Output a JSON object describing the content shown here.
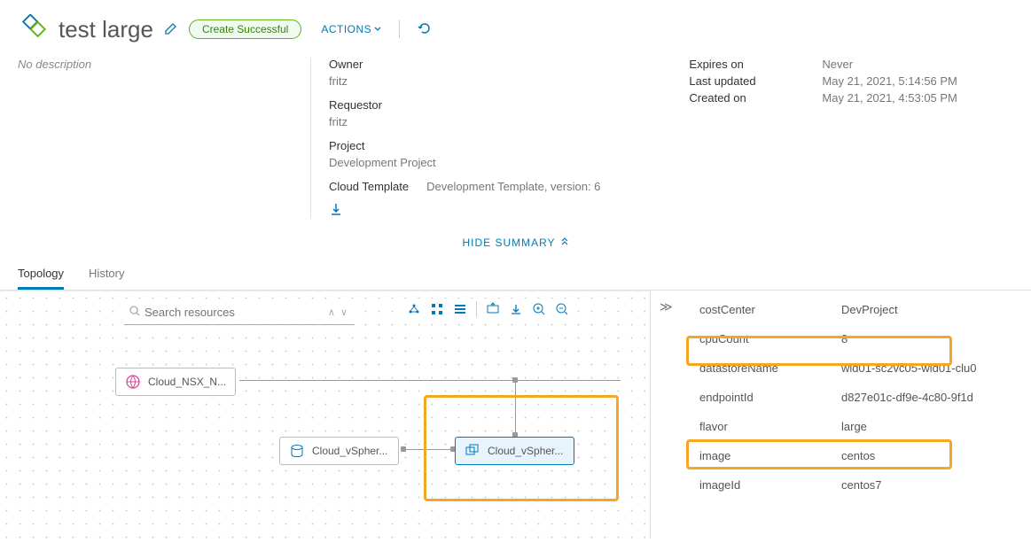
{
  "header": {
    "title": "test large",
    "status": "Create Successful",
    "actions_label": "ACTIONS"
  },
  "summary": {
    "description": "No description",
    "owner_label": "Owner",
    "owner_value": "fritz",
    "requestor_label": "Requestor",
    "requestor_value": "fritz",
    "project_label": "Project",
    "project_value": "Development Project",
    "template_label": "Cloud Template",
    "template_value": "Development Template, version: 6",
    "expires_label": "Expires on",
    "expires_value": "Never",
    "updated_label": "Last updated",
    "updated_value": "May 21, 2021, 5:14:56 PM",
    "created_label": "Created on",
    "created_value": "May 21, 2021, 4:53:05 PM",
    "hide_summary": "HIDE SUMMARY"
  },
  "tabs": {
    "topology": "Topology",
    "history": "History"
  },
  "search": {
    "placeholder": "Search resources"
  },
  "nodes": {
    "nsx": "Cloud_NSX_N...",
    "ds": "Cloud_vSpher...",
    "vm": "Cloud_vSpher..."
  },
  "props": {
    "costCenter": {
      "k": "costCenter",
      "v": "DevProject"
    },
    "cpuCount": {
      "k": "cpuCount",
      "v": "8"
    },
    "datastoreName": {
      "k": "datastoreName",
      "v": "wld01-sc2vc05-wld01-clu0"
    },
    "endpointId": {
      "k": "endpointId",
      "v": "d827e01c-df9e-4c80-9f1d"
    },
    "flavor": {
      "k": "flavor",
      "v": "large"
    },
    "image": {
      "k": "image",
      "v": "centos"
    },
    "imageId": {
      "k": "imageId",
      "v": "centos7"
    }
  }
}
